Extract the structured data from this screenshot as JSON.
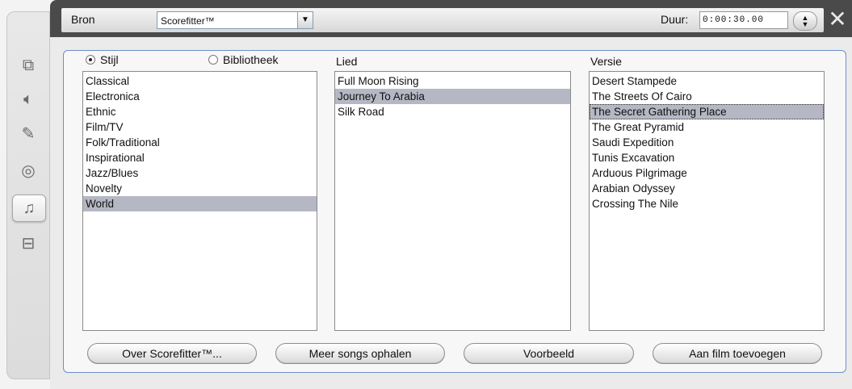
{
  "rail": {
    "icons": [
      "video-edit-icon",
      "speaker-icon",
      "microphone-icon",
      "disc-icon",
      "music-note-icon",
      "plug-icon"
    ],
    "active": "music-note-icon"
  },
  "top": {
    "bron_label": "Bron",
    "bron_value": "Scorefitter™",
    "duur_label": "Duur:",
    "duur_value": "0:00:30.00"
  },
  "radios": {
    "stijl": "Stijl",
    "bibliotheek": "Bibliotheek",
    "selected": "stijl"
  },
  "columns": {
    "lied_label": "Lied",
    "versie_label": "Versie"
  },
  "stijl_list": {
    "items": [
      "Classical",
      "Electronica",
      "Ethnic",
      "Film/TV",
      "Folk/Traditional",
      "Inspirational",
      "Jazz/Blues",
      "Novelty",
      "World"
    ],
    "selected_index": 8
  },
  "lied_list": {
    "items": [
      "Full Moon Rising",
      "Journey To Arabia",
      "Silk Road"
    ],
    "selected_index": 1
  },
  "versie_list": {
    "items": [
      "Desert Stampede",
      "The Streets Of Cairo",
      "The Secret Gathering Place",
      "The Great Pyramid",
      "Saudi Expedition",
      "Tunis Excavation",
      "Arduous Pilgrimage",
      "Arabian Odyssey",
      "Crossing The Nile"
    ],
    "selected_index": 2
  },
  "buttons": {
    "over": "Over Scorefitter™...",
    "meer": "Meer songs ophalen",
    "voorbeeld": "Voorbeeld",
    "toevoegen": "Aan film toevoegen"
  }
}
